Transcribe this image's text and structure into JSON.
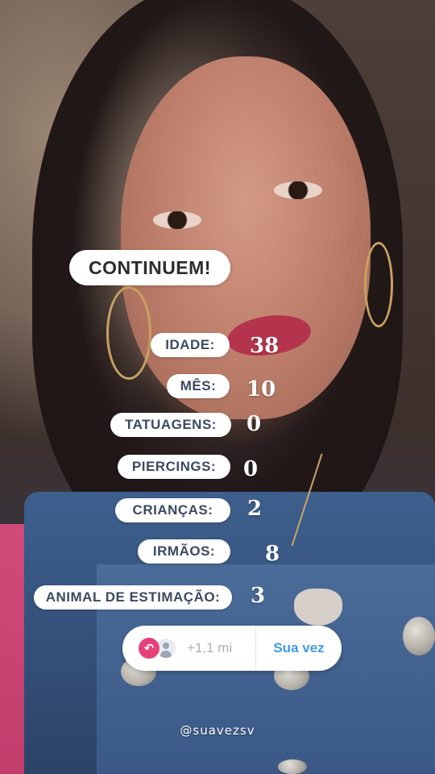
{
  "title": "CONTINUEM!",
  "rows": [
    {
      "label": "IDADE:",
      "value": "38"
    },
    {
      "label": "MÊS:",
      "value": "10"
    },
    {
      "label": "TATUAGENS:",
      "value": "0"
    },
    {
      "label": "PIERCINGS:",
      "value": "0"
    },
    {
      "label": "CRIANÇAS:",
      "value": "2"
    },
    {
      "label": "IRMÃOS:",
      "value": "8"
    },
    {
      "label": "ANIMAL DE ESTIMAÇÃO:",
      "value": "3"
    }
  ],
  "reply_bar": {
    "count": "+1,1 mi",
    "action": "Sua vez",
    "reply_icon": "reply-arrow-icon",
    "avatar_icon": "user-avatar-icon",
    "accent": "#e6407a",
    "action_color": "#3d9be9"
  },
  "handle": "@suavezsv"
}
